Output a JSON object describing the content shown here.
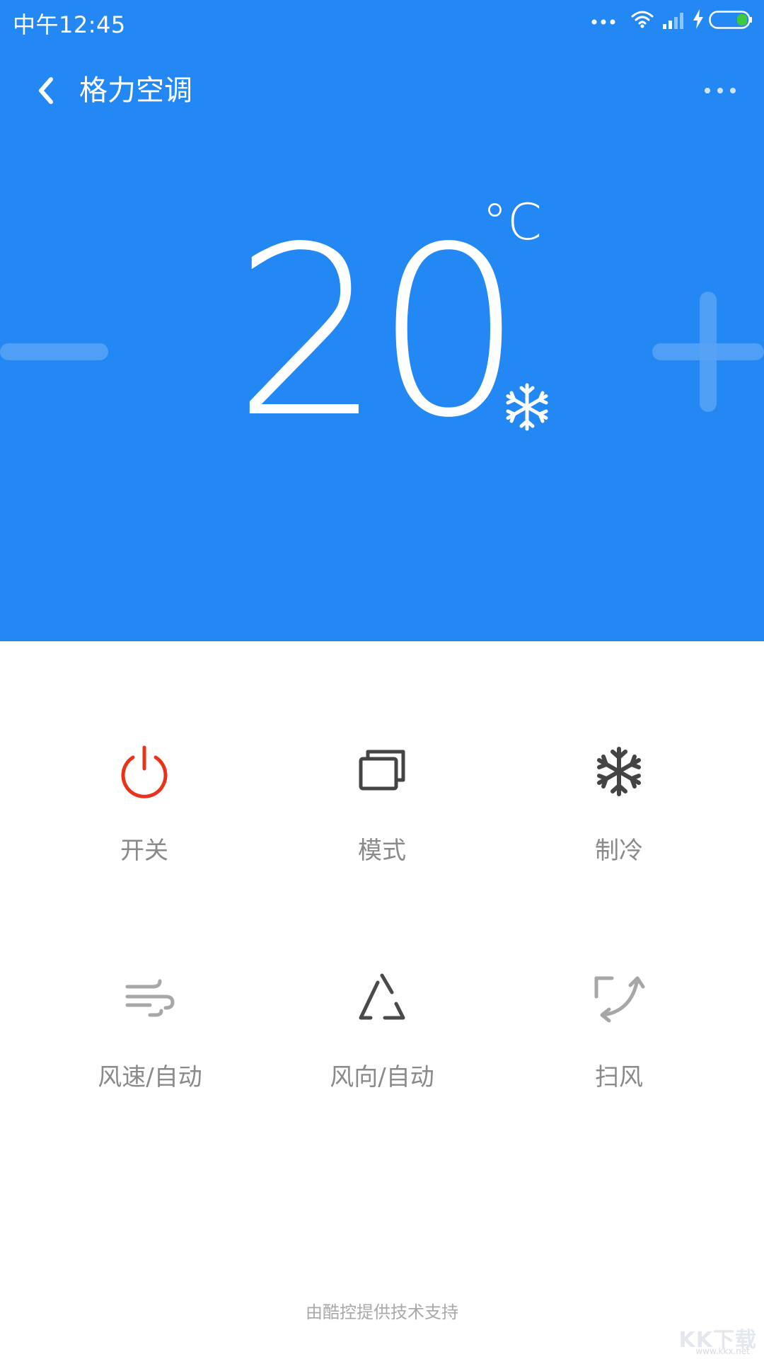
{
  "status_bar": {
    "time": "中午12:45"
  },
  "app_bar": {
    "title": "格力空调"
  },
  "thermostat": {
    "temperature": "20",
    "unit": "°C",
    "mode_icon": "snowflake-icon"
  },
  "controls": [
    {
      "label": "开关",
      "icon": "power-icon",
      "color": "#e8321a"
    },
    {
      "label": "模式",
      "icon": "mode-windows-icon",
      "color": "#444444"
    },
    {
      "label": "制冷",
      "icon": "snowflake-icon",
      "color": "#444444"
    },
    {
      "label": "风速/自动",
      "icon": "wind-icon",
      "color": "#a7a7a7"
    },
    {
      "label": "风向/自动",
      "icon": "triangle-icon",
      "color": "#4a4a4a"
    },
    {
      "label": "扫风",
      "icon": "swing-icon",
      "color": "#a7a7a7"
    }
  ],
  "footer": {
    "note": "由酷控提供技术支持"
  },
  "watermark": {
    "main": "KK下载",
    "sub": "www.kkx.net"
  },
  "colors": {
    "header_blue": "#2388f4",
    "power_red": "#e8321a",
    "label_gray": "#8a8a8a"
  }
}
